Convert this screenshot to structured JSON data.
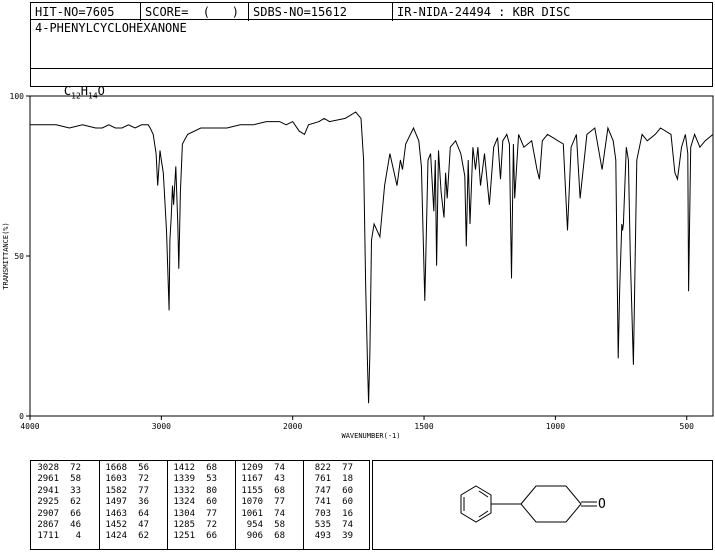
{
  "header": {
    "hit_no": "HIT-NO=7605",
    "score": "SCORE=  (   )",
    "sdbs_no": "SDBS-NO=15612",
    "ir_info": "IR-NIDA-24494 : KBR DISC",
    "compound_name": "4-PHENYLCYCLOHEXANONE",
    "formula_c": "C",
    "formula_c_count": "12",
    "formula_h": "H",
    "formula_h_count": "14",
    "formula_o": "O"
  },
  "chart_data": {
    "type": "line",
    "xlabel": "WAVENUMBER(-1)",
    "ylabel": "TRANSMITTANCE(%)",
    "xlim": [
      4000,
      400
    ],
    "ylim": [
      0,
      100
    ],
    "xticks": [
      4000,
      3000,
      2000,
      1500,
      1000,
      500
    ],
    "xtick_labels": [
      "4000",
      "3000",
      "2000",
      "1500",
      "1000",
      "500"
    ],
    "yticks": [
      0,
      50,
      100
    ],
    "ytick_labels": [
      "0",
      "50",
      "100"
    ],
    "grid": false,
    "series": [
      {
        "x": [
          4000,
          3900,
          3800,
          3700,
          3600,
          3500,
          3450,
          3400,
          3350,
          3300,
          3250,
          3200,
          3150,
          3100,
          3085,
          3062,
          3040,
          3028,
          3010,
          3000,
          2985,
          2961,
          2941,
          2935,
          2925,
          2915,
          2907,
          2890,
          2875,
          2867,
          2855,
          2840,
          2800,
          2700,
          2600,
          2500,
          2400,
          2300,
          2200,
          2100,
          2050,
          2000,
          1975,
          1955,
          1940,
          1900,
          1880,
          1860,
          1800,
          1780,
          1760,
          1740,
          1730,
          1722,
          1715,
          1711,
          1706,
          1700,
          1690,
          1668,
          1650,
          1630,
          1603,
          1590,
          1582,
          1570,
          1540,
          1520,
          1510,
          1497,
          1485,
          1475,
          1463,
          1457,
          1452,
          1445,
          1435,
          1424,
          1418,
          1412,
          1400,
          1380,
          1360,
          1345,
          1339,
          1332,
          1325,
          1314,
          1304,
          1295,
          1285,
          1270,
          1251,
          1235,
          1220,
          1209,
          1200,
          1185,
          1175,
          1167,
          1160,
          1155,
          1140,
          1120,
          1090,
          1070,
          1061,
          1050,
          1030,
          1010,
          990,
          970,
          954,
          940,
          920,
          906,
          880,
          850,
          822,
          800,
          780,
          770,
          761,
          755,
          747,
          744,
          741,
          730,
          722,
          715,
          703,
          690,
          670,
          650,
          620,
          600,
          560,
          545,
          535,
          520,
          505,
          496,
          493,
          485,
          470,
          450,
          430,
          400
        ],
        "y": [
          91,
          91,
          91,
          90,
          91,
          90,
          90,
          91,
          90,
          90,
          91,
          90,
          91,
          91,
          90,
          88,
          82,
          72,
          83,
          80,
          76,
          58,
          33,
          55,
          62,
          72,
          66,
          78,
          60,
          46,
          70,
          85,
          88,
          90,
          90,
          90,
          91,
          91,
          92,
          92,
          91,
          92,
          89,
          88,
          91,
          92,
          93,
          92,
          93,
          94,
          95,
          93,
          80,
          40,
          15,
          4,
          20,
          55,
          60,
          56,
          72,
          82,
          72,
          80,
          77,
          85,
          90,
          86,
          78,
          36,
          80,
          82,
          64,
          80,
          47,
          83,
          70,
          62,
          76,
          68,
          84,
          86,
          82,
          75,
          53,
          80,
          60,
          84,
          77,
          84,
          72,
          82,
          66,
          84,
          87,
          74,
          86,
          88,
          85,
          43,
          85,
          68,
          88,
          84,
          86,
          77,
          74,
          86,
          88,
          87,
          86,
          85,
          58,
          84,
          88,
          68,
          88,
          90,
          77,
          90,
          86,
          80,
          18,
          40,
          60,
          58,
          60,
          84,
          80,
          50,
          16,
          80,
          88,
          86,
          88,
          90,
          88,
          76,
          74,
          84,
          88,
          82,
          39,
          84,
          88,
          84,
          86,
          88
        ]
      }
    ]
  },
  "peak_table": [
    [
      [
        "3028",
        "72"
      ],
      [
        "2961",
        "58"
      ],
      [
        "2941",
        "33"
      ],
      [
        "2925",
        "62"
      ],
      [
        "2907",
        "66"
      ],
      [
        "2867",
        "46"
      ],
      [
        "1711",
        "4"
      ]
    ],
    [
      [
        "1668",
        "56"
      ],
      [
        "1603",
        "72"
      ],
      [
        "1582",
        "77"
      ],
      [
        "1497",
        "36"
      ],
      [
        "1463",
        "64"
      ],
      [
        "1452",
        "47"
      ],
      [
        "1424",
        "62"
      ]
    ],
    [
      [
        "1412",
        "68"
      ],
      [
        "1339",
        "53"
      ],
      [
        "1332",
        "80"
      ],
      [
        "1324",
        "60"
      ],
      [
        "1304",
        "77"
      ],
      [
        "1285",
        "72"
      ],
      [
        "1251",
        "66"
      ]
    ],
    [
      [
        "1209",
        "74"
      ],
      [
        "1167",
        "43"
      ],
      [
        "1155",
        "68"
      ],
      [
        "1070",
        "77"
      ],
      [
        "1061",
        "74"
      ],
      [
        "954",
        "58"
      ],
      [
        "906",
        "68"
      ]
    ],
    [
      [
        "822",
        "77"
      ],
      [
        "761",
        "18"
      ],
      [
        "747",
        "60"
      ],
      [
        "741",
        "60"
      ],
      [
        "703",
        "16"
      ],
      [
        "535",
        "74"
      ],
      [
        "493",
        "39"
      ]
    ]
  ],
  "structure": {
    "oxygen_label": "O"
  }
}
